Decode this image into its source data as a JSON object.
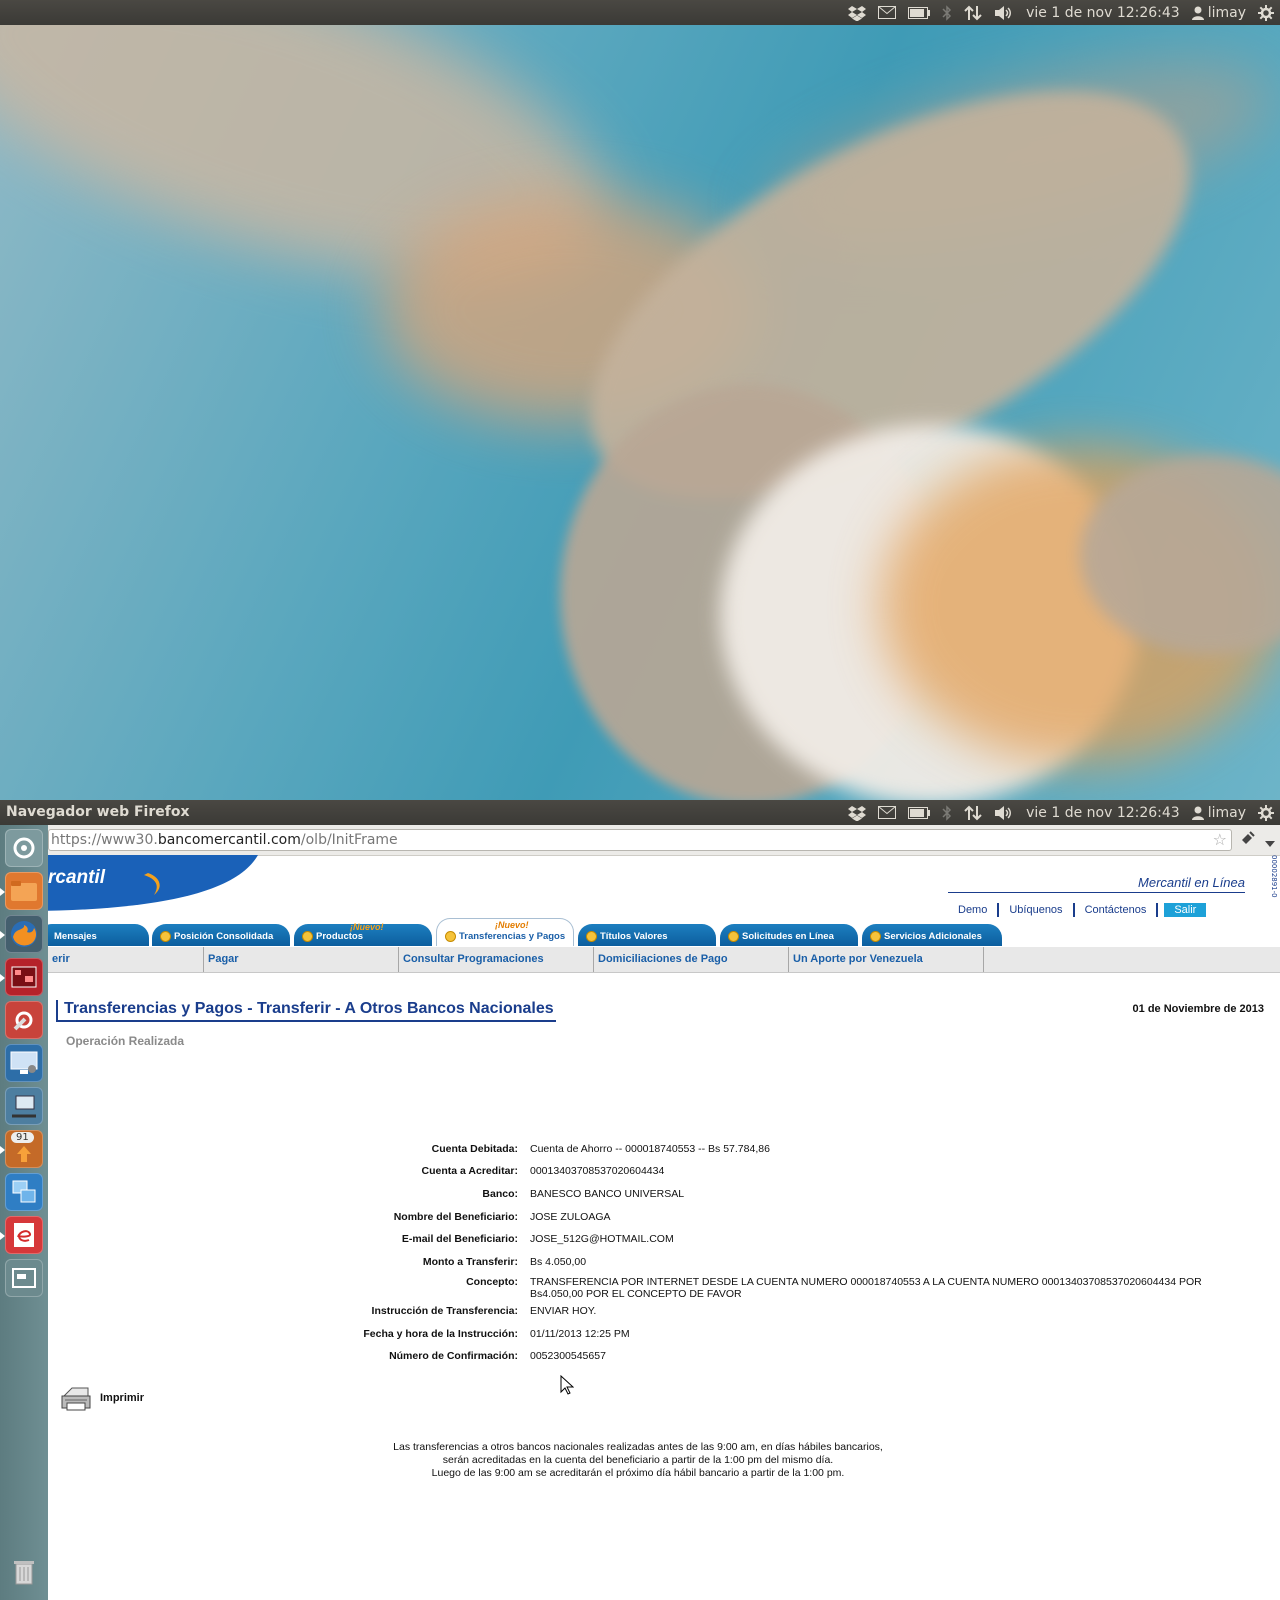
{
  "panel": {
    "window_title": "Navegador web Firefox",
    "clock": "vie  1 de nov 12:26:43",
    "user": "limay"
  },
  "launcher": {
    "items": [
      "dash-icon",
      "files-icon",
      "firefox-icon",
      "workspace-app-icon",
      "system-settings-icon",
      "remote-desktop-icon",
      "network-icon",
      "software-updater-icon",
      "virtualbox-icon",
      "text-editor-icon",
      "workspaces-icon",
      "trash-icon"
    ],
    "update_count": "91"
  },
  "browser": {
    "url_prefix": "https://www30.",
    "url_domain": "bancomercantil.com",
    "url_path": "/olb/InitFrame"
  },
  "site": {
    "logo_text": "rcantil",
    "mercantil_en_linea": "Mercantil en Línea",
    "links": [
      "Demo",
      "Ubíquenos",
      "Contáctenos"
    ],
    "salir": "Salir",
    "vertical_id": "00002891-0",
    "tabs": [
      {
        "label": "Mensajes"
      },
      {
        "label": "Posición Consolidada"
      },
      {
        "label": "Productos",
        "badge": "¡Nuevo!"
      },
      {
        "label": "Transferencias y Pagos",
        "badge": "¡Nuevo!"
      },
      {
        "label": "Títulos Valores"
      },
      {
        "label": "Solicitudes en Línea"
      },
      {
        "label": "Servicios Adicionales"
      }
    ],
    "subnav": [
      "erir",
      "Pagar",
      "Consultar Programaciones",
      "Domiciliaciones de Pago",
      "Un Aporte por Venezuela"
    ]
  },
  "page": {
    "title": "Transferencias y Pagos - Transferir - A Otros Bancos Nacionales",
    "date": "01 de Noviembre de 2013",
    "status": "Operación Realizada",
    "details": [
      {
        "label": "Cuenta Debitada:",
        "value": "Cuenta de Ahorro -- 000018740553 -- Bs 57.784,86"
      },
      {
        "label": "Cuenta a Acreditar:",
        "value": "00013403708537020604434"
      },
      {
        "label": "Banco:",
        "value": "BANESCO BANCO UNIVERSAL"
      },
      {
        "label": "Nombre del Beneficiario:",
        "value": "JOSE ZULOAGA"
      },
      {
        "label": "E-mail del Beneficiario:",
        "value": "JOSE_512G@HOTMAIL.COM"
      },
      {
        "label": "Monto a Transferir:",
        "value": "Bs 4.050,00"
      },
      {
        "label": "Concepto:",
        "value": "TRANSFERENCIA POR INTERNET DESDE LA CUENTA NUMERO 000018740553 A LA CUENTA NUMERO 00013403708537020604434 POR Bs4.050,00 POR EL CONCEPTO DE FAVOR"
      },
      {
        "label": "Instrucción de Transferencia:",
        "value": "ENVIAR HOY."
      },
      {
        "label": "Fecha y hora de la Instrucción:",
        "value": "01/11/2013 12:25 PM"
      },
      {
        "label": "Número de Confirmación:",
        "value": "0052300545657"
      }
    ],
    "print_label": "Imprimir",
    "note": [
      "Las transferencias a otros bancos nacionales realizadas antes de las 9:00 am, en días hábiles bancarios,",
      "serán acreditadas en la cuenta del beneficiario a partir de la 1:00 pm del mismo día.",
      "Luego de las 9:00 am se acreditarán el próximo día hábil bancario a partir de la 1:00 pm."
    ]
  }
}
